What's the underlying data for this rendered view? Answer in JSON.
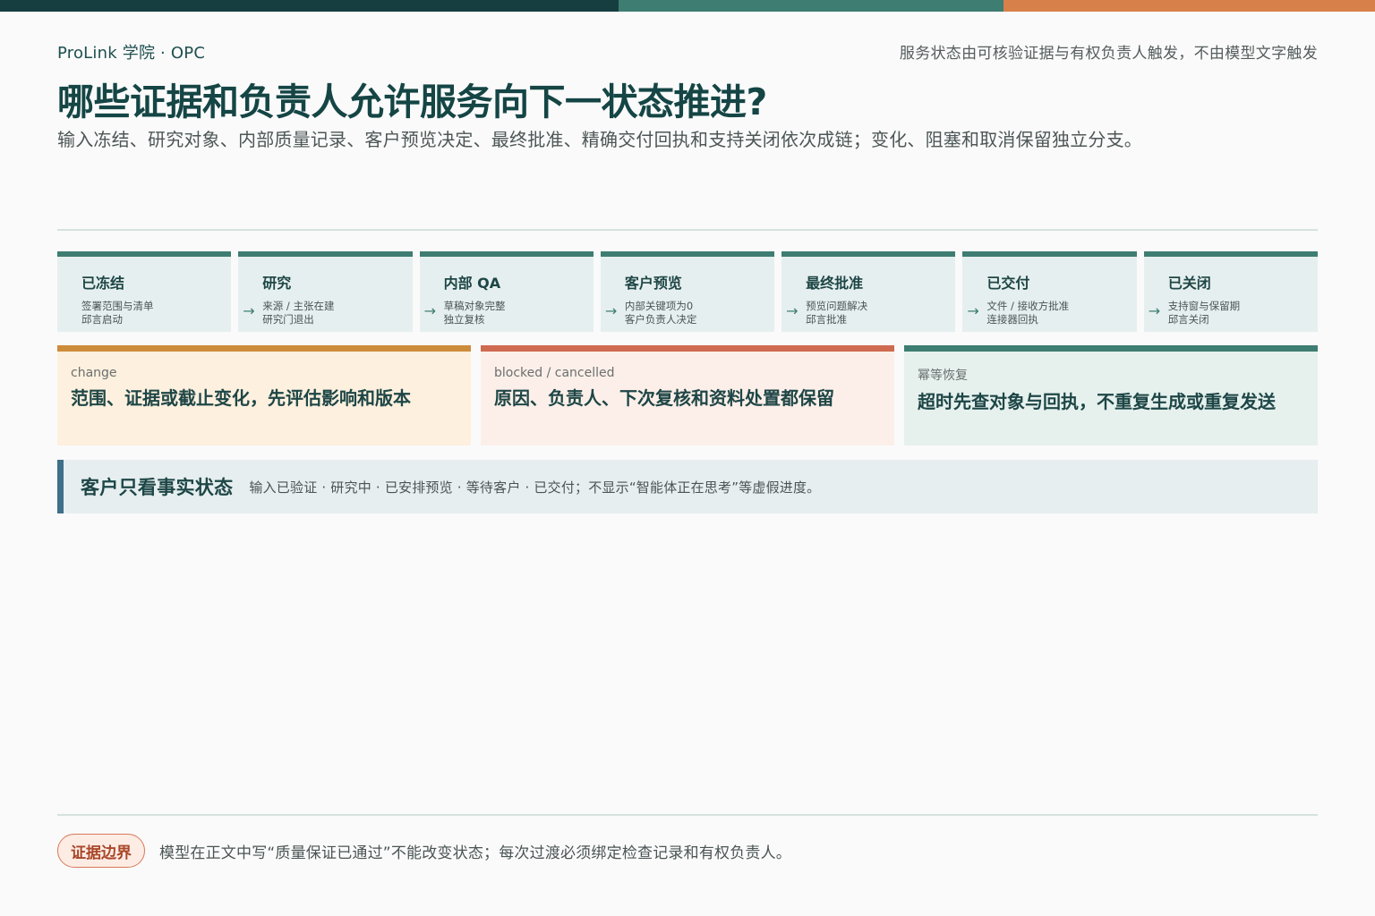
{
  "colors": {
    "bar_dark": "#163d40",
    "bar_teal": "#3e7d72",
    "bar_orange": "#d8804a",
    "stage_border": "#3e7d72",
    "change_accent": "#cc8c3c",
    "blocked_accent": "#cf6a50",
    "resume_accent": "#3e7d72",
    "callout_accent": "#3f6f89"
  },
  "header": {
    "brand": "ProLink 学院 · OPC",
    "tagline": "服务状态由可核验证据与有权负责人触发，不由模型文字触发",
    "title": "哪些证据和负责人允许服务向下一状态推进?",
    "subtitle": "输入冻结、研究对象、内部质量记录、客户预览决定、最终批准、精确交付回执和支持关闭依次成链；变化、阻塞和取消保留独立分支。"
  },
  "stages": [
    {
      "name": "已冻结",
      "line1": "签署范围与清单",
      "line2": "邱言启动",
      "arrow": ""
    },
    {
      "name": "研究",
      "line1": "来源 / 主张在建",
      "line2": "研究门退出",
      "arrow": "→"
    },
    {
      "name": "内部 QA",
      "line1": "草稿对象完整",
      "line2": "独立复核",
      "arrow": "→"
    },
    {
      "name": "客户预览",
      "line1": "内部关键项为0",
      "line2": "客户负责人决定",
      "arrow": "→"
    },
    {
      "name": "最终批准",
      "line1": "预览问题解决",
      "line2": "邱言批准",
      "arrow": "→"
    },
    {
      "name": "已交付",
      "line1": "文件 / 接收方批准",
      "line2": "连接器回执",
      "arrow": "→"
    },
    {
      "name": "已关闭",
      "line1": "支持窗与保留期",
      "line2": "邱言关闭",
      "arrow": "→"
    }
  ],
  "branches": {
    "change": {
      "tag": "change",
      "text": "范围、证据或截止变化，先评估影响和版本"
    },
    "blocked": {
      "tag": "blocked / cancelled",
      "text": "原因、负责人、下次复核和资料处置都保留"
    },
    "resume": {
      "tag": "幂等恢复",
      "text": "超时先查对象与回执，不重复生成或重复发送"
    }
  },
  "callout": {
    "title": "客户只看事实状态",
    "text": "输入已验证 · 研究中 · 已安排预览 · 等待客户 · 已交付；不显示“智能体正在思考”等虚假进度。"
  },
  "footer": {
    "pill": "证据边界",
    "text": "模型在正文中写“质量保证已通过”不能改变状态；每次过渡必须绑定检查记录和有权负责人。"
  }
}
